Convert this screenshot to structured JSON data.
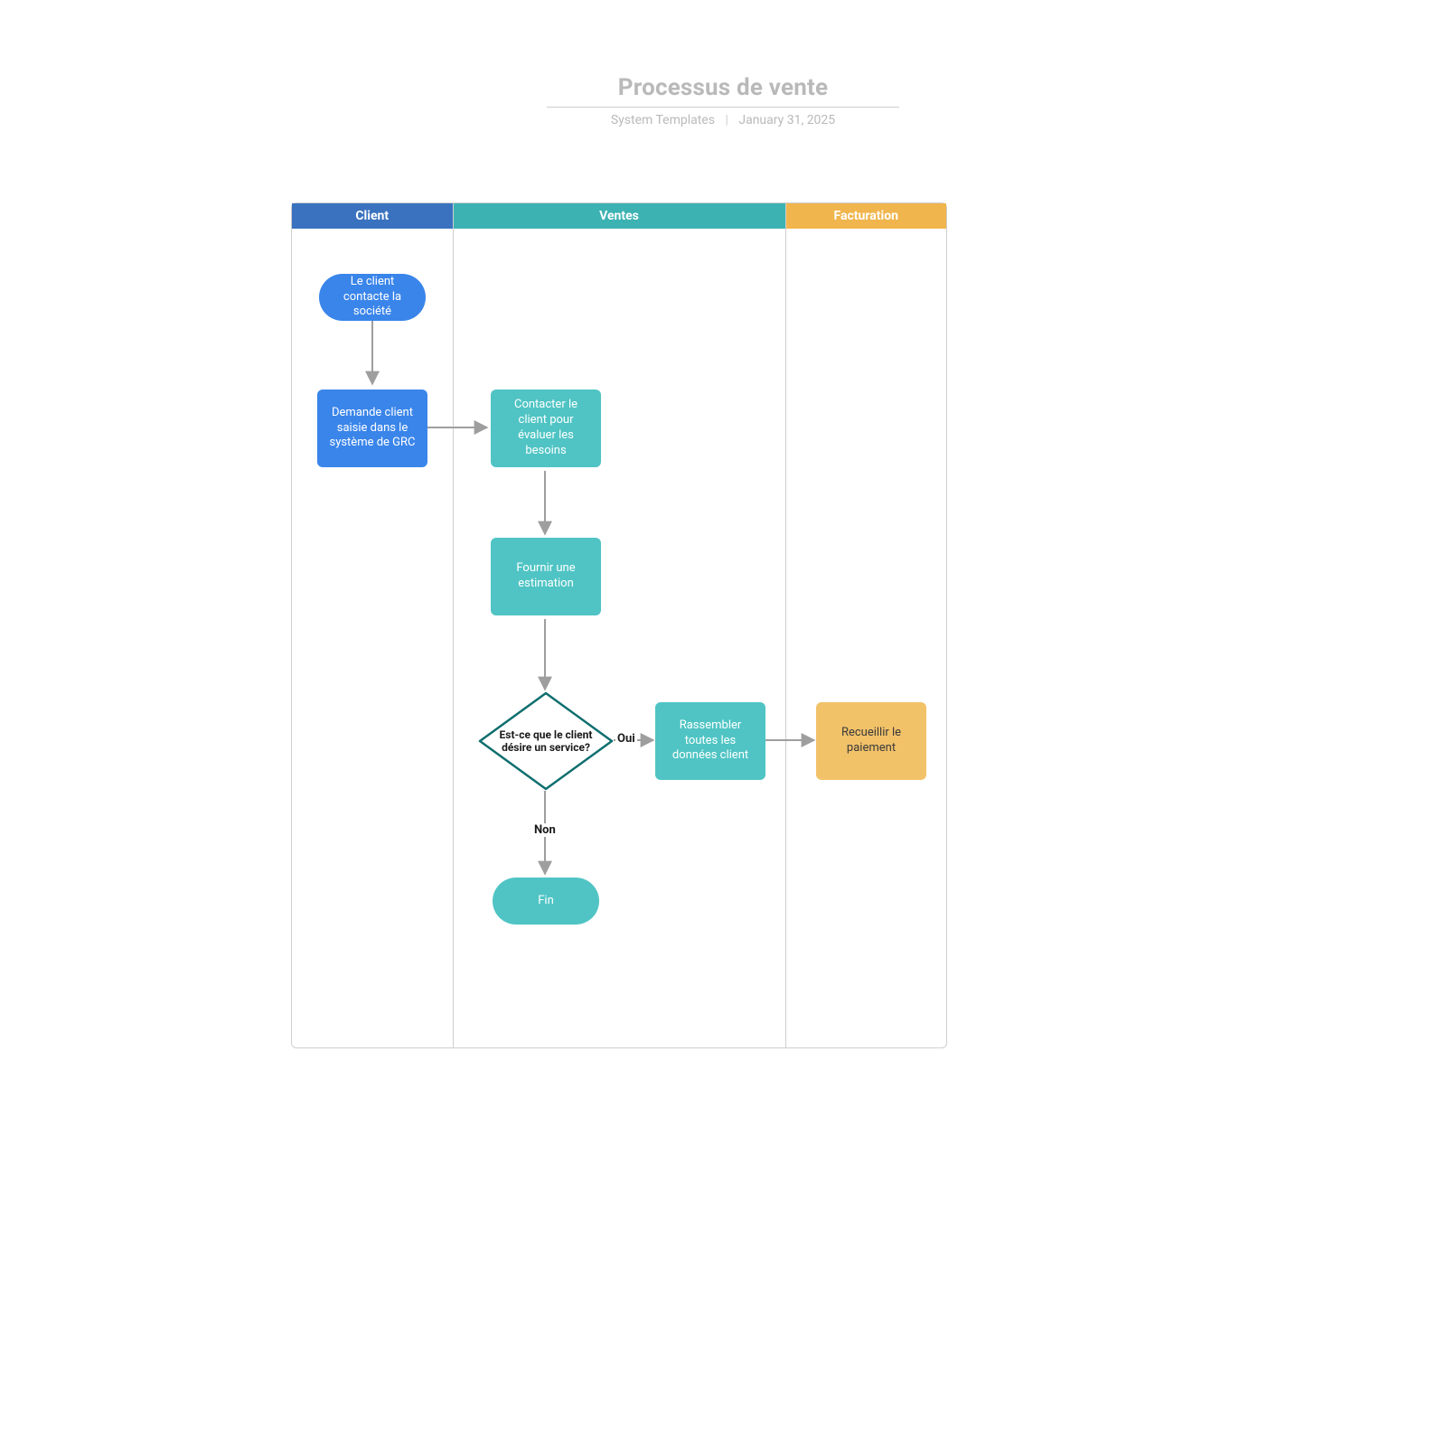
{
  "header": {
    "title": "Processus de vente",
    "author": "System Templates",
    "date": "January 31, 2025"
  },
  "lanes": {
    "client": "Client",
    "sales": "Ventes",
    "billing": "Facturation"
  },
  "nodes": {
    "start": "Le client contacte la société",
    "crm": "Demande client saisie dans le système de GRC",
    "contact": "Contacter le client pour évaluer les besoins",
    "estimate": "Fournir une estimation",
    "decision": "Est-ce que le client désire un service?",
    "gather": "Rassembler toutes les données client",
    "payment": "Recueillir le paiement",
    "end": "Fin"
  },
  "edges": {
    "yes": "Oui",
    "no": "Non"
  }
}
